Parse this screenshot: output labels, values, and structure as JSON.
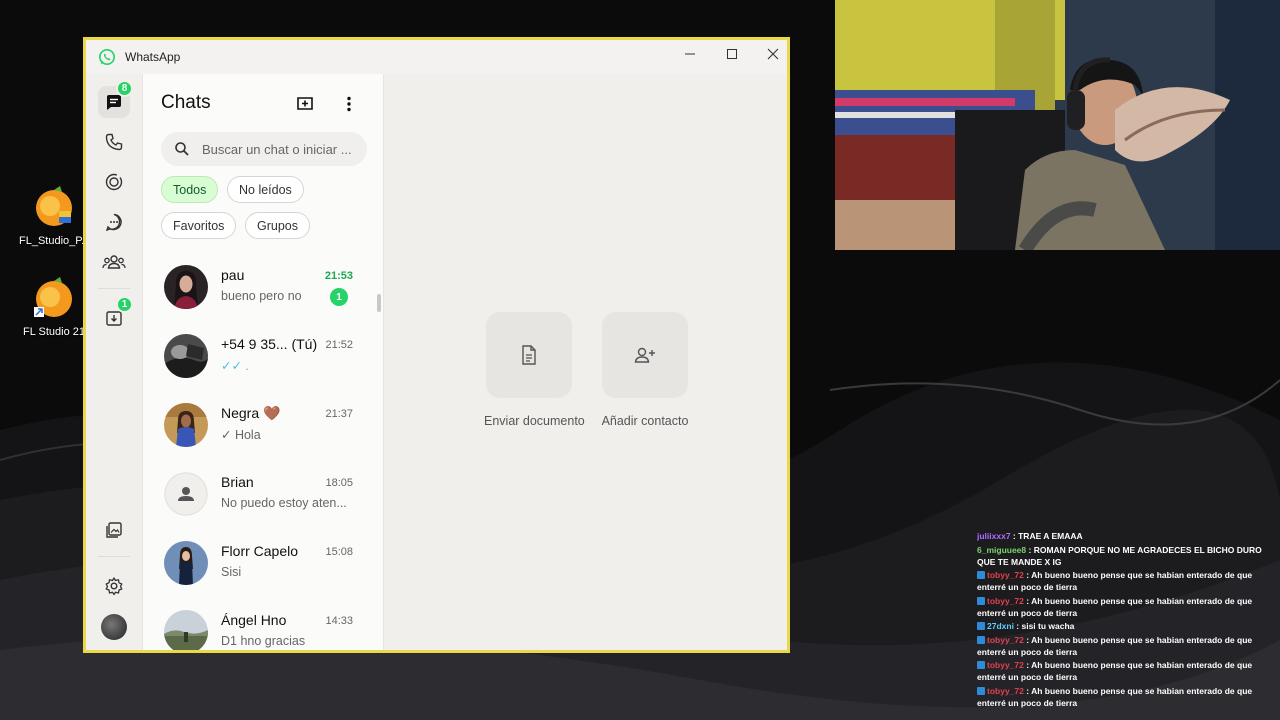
{
  "desktop": {
    "icons": [
      {
        "label": "FL_Studio_P..."
      },
      {
        "label": "FL Studio 21"
      }
    ]
  },
  "window": {
    "title": "WhatsApp",
    "controls": {
      "minimize": "—",
      "maximize": "☐",
      "close": "✕"
    }
  },
  "rail": {
    "chats_badge": "8",
    "archived_badge": "1"
  },
  "panel": {
    "heading": "Chats",
    "search_placeholder": "Buscar un chat o iniciar ...",
    "filters": [
      "Todos",
      "No leídos",
      "Favoritos",
      "Grupos"
    ],
    "chats": [
      {
        "name": "pau",
        "time": "21:53",
        "message": "bueno pero no",
        "unread": "1"
      },
      {
        "name": "+54 9 35...   (Tú)",
        "time": "21:52",
        "message": "✓✓ ."
      },
      {
        "name": "Negra 🤎",
        "time": "21:37",
        "message": "✓ Hola"
      },
      {
        "name": "Brian",
        "time": "18:05",
        "message": "No puedo estoy aten..."
      },
      {
        "name": "Florr Capelo",
        "time": "15:08",
        "message": "Sisi"
      },
      {
        "name": "Ángel Hno",
        "time": "14:33",
        "message": "D1 hno gracias"
      }
    ]
  },
  "main": {
    "actions": [
      {
        "label": "Enviar documento",
        "icon": "document-icon"
      },
      {
        "label": "Añadir contacto",
        "icon": "add-contact-icon"
      }
    ]
  },
  "stream_chat": [
    {
      "user": "juliixxx7",
      "text": " : TRAE A EMAAA",
      "color": "u1",
      "badge": false
    },
    {
      "user": "6_miguuee8",
      "text": " : ROMAN PORQUE NO ME AGRADECES EL BICHO DURO QUE TE MANDE X IG",
      "color": "u2",
      "badge": false
    },
    {
      "user": "tobyy_72",
      "text": " : Ah bueno bueno pense que se habian enterado de que enterré un poco de tierra",
      "color": "u3",
      "badge": true
    },
    {
      "user": "tobyy_72",
      "text": " : Ah bueno bueno pense que se habian enterado de que enterré un poco de tierra",
      "color": "u3",
      "badge": true
    },
    {
      "user": "27dxni",
      "text": " : sisi tu wacha",
      "color": "u4",
      "badge": true
    },
    {
      "user": "tobyy_72",
      "text": " : Ah bueno bueno pense que se habian enterado de que enterré un poco de tierra",
      "color": "u3",
      "badge": true
    },
    {
      "user": "tobyy_72",
      "text": " : Ah bueno bueno pense que se habian enterado de que enterré un poco de tierra",
      "color": "u3",
      "badge": true
    },
    {
      "user": "tobyy_72",
      "text": " : Ah bueno bueno pense que se habian enterado de que enterré un poco de tierra",
      "color": "u3",
      "badge": true
    }
  ]
}
